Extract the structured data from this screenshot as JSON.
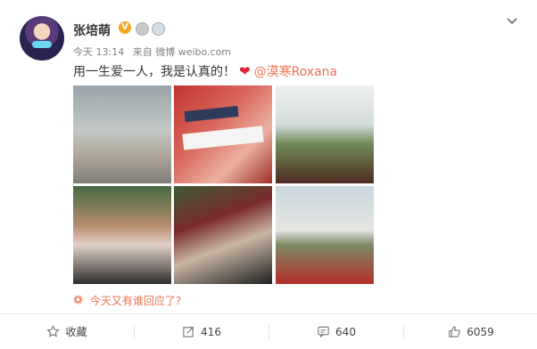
{
  "post": {
    "username": "张培萌",
    "badge_v": "V",
    "meta_time": "今天 13:14",
    "meta_source": "来自 微博 weibo.com",
    "text": "用一生爱一人，我是认真的！",
    "heart": "❤",
    "mention": "@漠寒Roxana",
    "photos": [
      "photo-1",
      "photo-2",
      "photo-3",
      "photo-4",
      "photo-5",
      "photo-6"
    ],
    "topic": "今天又有谁回应了?",
    "topic_icon": "gear-icon"
  },
  "actions": {
    "favorite": "收藏",
    "repost": "416",
    "comment": "640",
    "like": "6059"
  },
  "colors": {
    "accent": "#eb7350",
    "heart": "#e0253a",
    "muted": "#808080"
  }
}
